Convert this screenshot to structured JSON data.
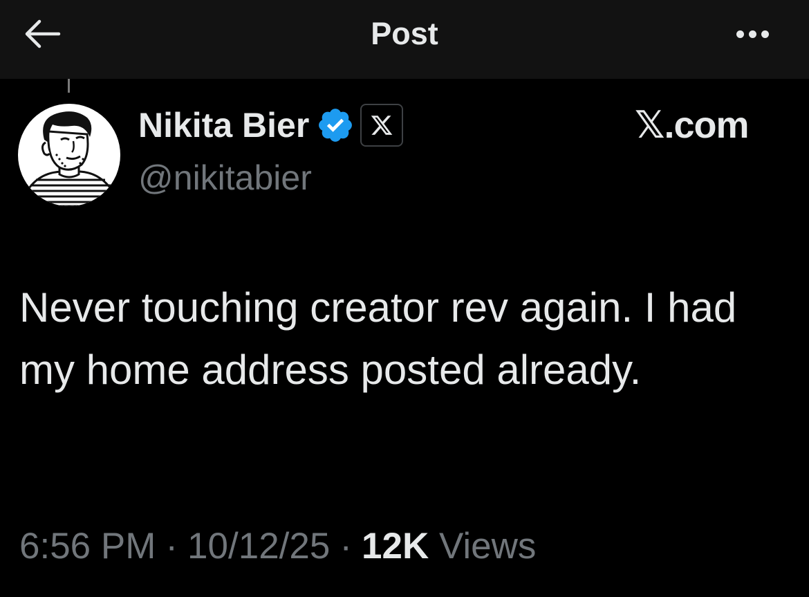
{
  "header": {
    "title": "Post",
    "back_icon": "arrow-left-icon",
    "more_icon": "more-horizontal-icon"
  },
  "author": {
    "display_name": "Nikita Bier",
    "handle": "@nikitabier",
    "verified_icon": "verified-badge-icon",
    "affiliate_badge_icon": "x-logo-icon",
    "affiliate_label": "𝕏.com"
  },
  "post": {
    "text": "Never touching creator rev again. I had my home address posted already."
  },
  "meta": {
    "time": "6:56 PM",
    "separator": "·",
    "date": "10/12/25",
    "views_count": "12K",
    "views_label": "Views"
  },
  "colors": {
    "background": "#000000",
    "header_background": "#121212",
    "text_primary": "#e7e9ea",
    "text_secondary": "#71767b",
    "verified_blue": "#1d9bf0"
  }
}
